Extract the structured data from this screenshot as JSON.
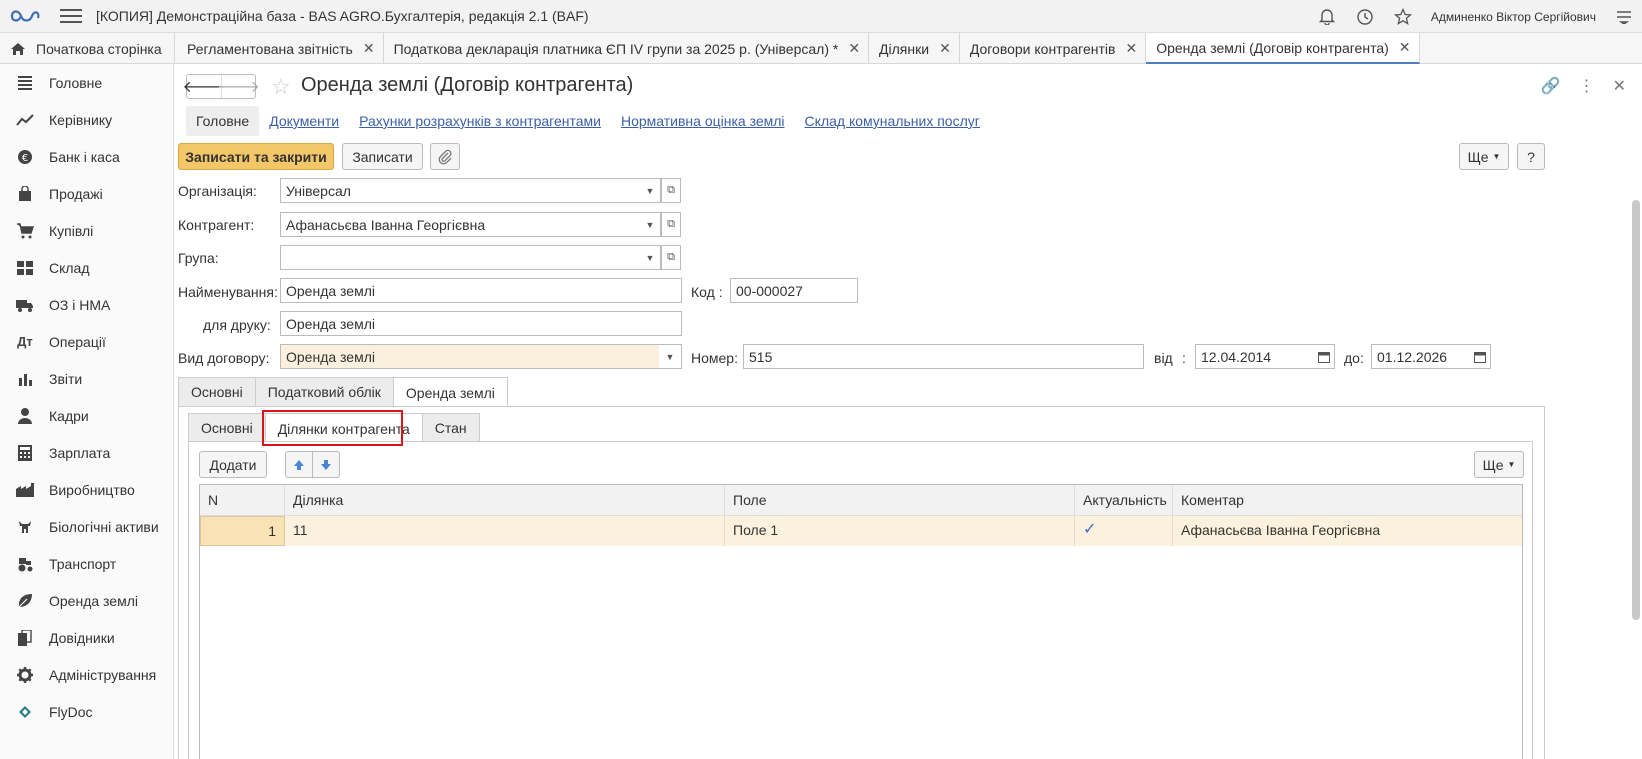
{
  "app": {
    "title": "[КОПИЯ] Демонстраційна база - BAS AGRO.Бухгалтерія, редакція 2.1  (BAF)",
    "user": "Админенко Віктор Сергійович"
  },
  "window_tabs": [
    {
      "label": "Початкова сторінка"
    },
    {
      "label": "Регламентована звітність"
    },
    {
      "label": "Податкова декларація платника ЄП IV групи за 2025 р. (Універсал) *"
    },
    {
      "label": "Ділянки"
    },
    {
      "label": "Договори контрагентів"
    },
    {
      "label": "Оренда землі (Договір контрагента)"
    }
  ],
  "sidebar": {
    "items": [
      {
        "label": "Головне"
      },
      {
        "label": "Керівнику"
      },
      {
        "label": "Банк і каса"
      },
      {
        "label": "Продажі"
      },
      {
        "label": "Купівлі"
      },
      {
        "label": "Склад"
      },
      {
        "label": "ОЗ і НМА"
      },
      {
        "label": "Операції"
      },
      {
        "label": "Звіти"
      },
      {
        "label": "Кадри"
      },
      {
        "label": "Зарплата"
      },
      {
        "label": "Виробництво"
      },
      {
        "label": "Біологічні активи"
      },
      {
        "label": "Транспорт"
      },
      {
        "label": "Оренда землі"
      },
      {
        "label": "Довідники"
      },
      {
        "label": "Адміністрування"
      },
      {
        "label": "FlyDoc"
      }
    ]
  },
  "form": {
    "title": "Оренда землі (Договір контрагента)",
    "sections": [
      "Головне",
      "Документи",
      "Рахунки розрахунків з контрагентами",
      "Нормативна оцінка землі",
      "Склад комунальних послуг"
    ],
    "buttons": {
      "save_close": "Записати та закрити",
      "save": "Записати",
      "more": "Ще",
      "help": "?"
    },
    "fields": {
      "org_label": "Організація:",
      "org_value": "Універсал",
      "counterparty_label": "Контрагент:",
      "counterparty_value": "Афанасьєва Іванна Георгієвна",
      "group_label": "Група:",
      "group_value": "",
      "name_label": "Найменування:",
      "name_value": "Оренда землі",
      "code_label": "Код :",
      "code_value": "00-000027",
      "print_label": "для друку:",
      "print_value": "Оренда землі",
      "type_label": "Вид договору:",
      "type_value": "Оренда землі",
      "number_label": "Номер:",
      "number_value": "515",
      "from_label": "від",
      "from_colon": ":",
      "from_value": "12.04.2014",
      "to_label": "до:",
      "to_value": "01.12.2026"
    },
    "page_tabs": [
      "Основні",
      "Податковий облік",
      "Оренда землі"
    ],
    "sub_tabs": [
      "Основні",
      "Ділянки контрагента",
      "Стан"
    ],
    "table_toolbar": {
      "add": "Додати",
      "more": "Ще"
    },
    "table": {
      "columns": [
        "N",
        "Ділянка",
        "Поле",
        "Актуальність",
        "Коментар"
      ],
      "rows": [
        {
          "n": "1",
          "plot": "11",
          "field": "Поле 1",
          "actual": "✓",
          "comment": "Афанасьєва Іванна Георгієвна"
        }
      ]
    }
  },
  "colors": {
    "accent": "#4a7dc8",
    "primary_button": "#f3c667",
    "highlight_border": "#d9141b",
    "selected_row": "#fbf1dc"
  }
}
